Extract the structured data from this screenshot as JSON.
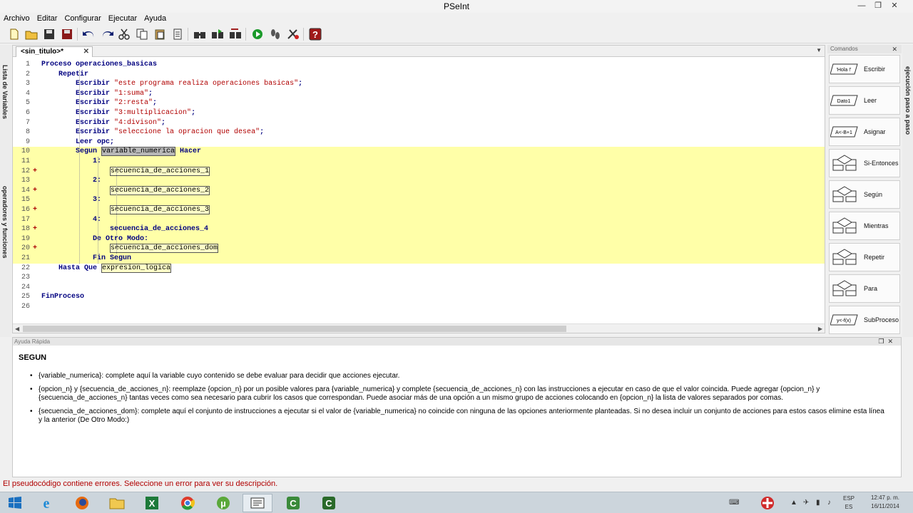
{
  "window": {
    "title": "PSeInt",
    "controls": [
      "—",
      "❐",
      "✕"
    ]
  },
  "menu": [
    "Archivo",
    "Editar",
    "Configurar",
    "Ejecutar",
    "Ayuda"
  ],
  "toolbar_icons": [
    "new-file-icon",
    "open-folder-icon",
    "save-icon",
    "save-as-icon",
    "undo-icon",
    "redo-icon",
    "cut-icon",
    "copy-icon",
    "paste-icon",
    "edit-icon",
    "find-icon",
    "find-next-icon",
    "replace-icon",
    "run-icon",
    "step-run-icon",
    "debug-icon",
    "help-icon"
  ],
  "left_panel": {
    "variables": "Lista de Variables",
    "operators": "operadores y funciones"
  },
  "right_panel": {
    "label": "ejecución paso a paso"
  },
  "editor": {
    "tab_label": "<sin_titulo>*",
    "tab_close": "✕",
    "lines": [
      {
        "n": "1",
        "fold": "",
        "hl": false,
        "parts": [
          {
            "t": "Proceso operaciones_basicas",
            "k": "kw"
          }
        ]
      },
      {
        "n": "2",
        "fold": "",
        "hl": false,
        "parts": [
          {
            "t": "    Repetir",
            "k": "kw"
          }
        ]
      },
      {
        "n": "3",
        "fold": "",
        "hl": false,
        "parts": [
          {
            "t": "        Escribir ",
            "k": "kw"
          },
          {
            "t": "\"este programa realiza operaciones basicas\"",
            "k": "st"
          },
          {
            "t": ";",
            "k": "kw"
          }
        ]
      },
      {
        "n": "4",
        "fold": "",
        "hl": false,
        "parts": [
          {
            "t": "        Escribir ",
            "k": "kw"
          },
          {
            "t": "\"1:suma\"",
            "k": "st"
          },
          {
            "t": ";",
            "k": "kw"
          }
        ]
      },
      {
        "n": "5",
        "fold": "",
        "hl": false,
        "parts": [
          {
            "t": "        Escribir ",
            "k": "kw"
          },
          {
            "t": "\"2:resta\"",
            "k": "st"
          },
          {
            "t": ";",
            "k": "kw"
          }
        ]
      },
      {
        "n": "6",
        "fold": "",
        "hl": false,
        "parts": [
          {
            "t": "        Escribir ",
            "k": "kw"
          },
          {
            "t": "\"3:multiplicacion\"",
            "k": "st"
          },
          {
            "t": ";",
            "k": "kw"
          }
        ]
      },
      {
        "n": "7",
        "fold": "",
        "hl": false,
        "parts": [
          {
            "t": "        Escribir ",
            "k": "kw"
          },
          {
            "t": "\"4:divison\"",
            "k": "st"
          },
          {
            "t": ";",
            "k": "kw"
          }
        ]
      },
      {
        "n": "8",
        "fold": "",
        "hl": false,
        "parts": [
          {
            "t": "        Escribir ",
            "k": "kw"
          },
          {
            "t": "\"seleccione la opracion que desea\"",
            "k": "st"
          },
          {
            "t": ";",
            "k": "kw"
          }
        ]
      },
      {
        "n": "9",
        "fold": "",
        "hl": false,
        "parts": [
          {
            "t": "        Leer opc;",
            "k": "kw"
          }
        ]
      },
      {
        "n": "10",
        "fold": "",
        "hl": true,
        "parts": [
          {
            "t": "        Segun ",
            "k": "kw"
          },
          {
            "t": "variable_numerica",
            "k": "phs"
          },
          {
            "t": " Hacer",
            "k": "kw"
          }
        ]
      },
      {
        "n": "11",
        "fold": "",
        "hl": true,
        "parts": [
          {
            "t": "            1:",
            "k": "kw"
          }
        ]
      },
      {
        "n": "12",
        "fold": "+",
        "hl": true,
        "parts": [
          {
            "t": "                ",
            "k": ""
          },
          {
            "t": "secuencia_de_acciones_1",
            "k": "ph"
          }
        ]
      },
      {
        "n": "13",
        "fold": "",
        "hl": true,
        "parts": [
          {
            "t": "            2:",
            "k": "kw"
          }
        ]
      },
      {
        "n": "14",
        "fold": "+",
        "hl": true,
        "parts": [
          {
            "t": "                ",
            "k": ""
          },
          {
            "t": "secuencia_de_acciones_2",
            "k": "ph"
          }
        ]
      },
      {
        "n": "15",
        "fold": "",
        "hl": true,
        "parts": [
          {
            "t": "            3:",
            "k": "kw"
          }
        ]
      },
      {
        "n": "16",
        "fold": "+",
        "hl": true,
        "parts": [
          {
            "t": "                ",
            "k": ""
          },
          {
            "t": "secuencia_de_acciones_3",
            "k": "ph"
          }
        ]
      },
      {
        "n": "17",
        "fold": "",
        "hl": true,
        "parts": [
          {
            "t": "            4:",
            "k": "kw"
          }
        ]
      },
      {
        "n": "18",
        "fold": "+",
        "hl": true,
        "parts": [
          {
            "t": "                ",
            "k": ""
          },
          {
            "t": "secuencia_de_acciones_4",
            "k": "kw"
          }
        ]
      },
      {
        "n": "19",
        "fold": "",
        "hl": true,
        "parts": [
          {
            "t": "            De Otro Modo:",
            "k": "kw"
          }
        ]
      },
      {
        "n": "20",
        "fold": "+",
        "hl": true,
        "parts": [
          {
            "t": "                ",
            "k": ""
          },
          {
            "t": "secuencia_de_acciones_dom",
            "k": "ph"
          }
        ]
      },
      {
        "n": "21",
        "fold": "",
        "hl": true,
        "parts": [
          {
            "t": "            Fin Segun",
            "k": "kw"
          }
        ]
      },
      {
        "n": "22",
        "fold": "",
        "hl": false,
        "parts": [
          {
            "t": "    Hasta Que ",
            "k": "kw"
          },
          {
            "t": "expresion_logica",
            "k": "ph"
          }
        ]
      },
      {
        "n": "23",
        "fold": "",
        "hl": false,
        "parts": []
      },
      {
        "n": "24",
        "fold": "",
        "hl": false,
        "parts": []
      },
      {
        "n": "25",
        "fold": "",
        "hl": false,
        "parts": [
          {
            "t": "FinProceso",
            "k": "kw"
          }
        ]
      },
      {
        "n": "26",
        "fold": "",
        "hl": false,
        "parts": []
      }
    ]
  },
  "commands": {
    "header": "Comandos",
    "close": "✕",
    "items": [
      {
        "label": "Escribir",
        "icon_text": "'Hola !'"
      },
      {
        "label": "Leer",
        "icon_text": "Dato1"
      },
      {
        "label": "Asignar",
        "icon_text": "A<-B+1"
      },
      {
        "label": "Si-Entonces",
        "icon_text": ""
      },
      {
        "label": "Según",
        "icon_text": ""
      },
      {
        "label": "Mientras",
        "icon_text": ""
      },
      {
        "label": "Repetir",
        "icon_text": ""
      },
      {
        "label": "Para",
        "icon_text": ""
      },
      {
        "label": "SubProceso",
        "icon_text": "y<-f(x)"
      }
    ]
  },
  "help": {
    "header": "Ayuda Rápida",
    "title": "SEGUN",
    "items": [
      "{variable_numerica}: complete aquí la variable cuyo contenido se debe evaluar para decidir que acciones ejecutar.",
      "{opcion_n} y {secuencia_de_acciones_n}: reemplaze {opcion_n} por un posible valores para {variable_numerica} y complete {secuencia_de_acciones_n} con las instrucciones a ejecutar en caso de que el valor coincida. Puede agregar {opcion_n} y {secuencia_de_acciones_n} tantas veces como sea necesario para cubrir los casos que correspondan. Puede asociar más de una opción a un mismo grupo de acciones colocando en {opcion_n} la lista de valores separados por comas.",
      "{secuencia_de_acciones_dom}: complete aquí el conjunto de instrucciones a ejecutar si el valor de {variable_numerica} no coincide con ninguna de las opciones anteriormente planteadas. Si no desea incluir un conjunto de acciones para estos casos elimine esta línea y la anterior (De Otro Modo:)"
    ]
  },
  "status": "El pseudocódigo contiene errores. Seleccione un error para ver su descripción.",
  "taskbar": {
    "apps": [
      "windows-start-icon",
      "internet-explorer-icon",
      "firefox-icon",
      "file-explorer-icon",
      "excel-icon",
      "chrome-icon",
      "utorrent-icon",
      "pseint-icon",
      "camtasia-icon",
      "camtasia-recorder-icon"
    ],
    "lang": "ESP",
    "lang_sub": "ES",
    "time": "12:47 p. m.",
    "date": "16/11/2014"
  },
  "colors": {
    "highlight": "#ffffa8",
    "keyword": "#000080",
    "string": "#b00000",
    "error": "#b00000"
  }
}
